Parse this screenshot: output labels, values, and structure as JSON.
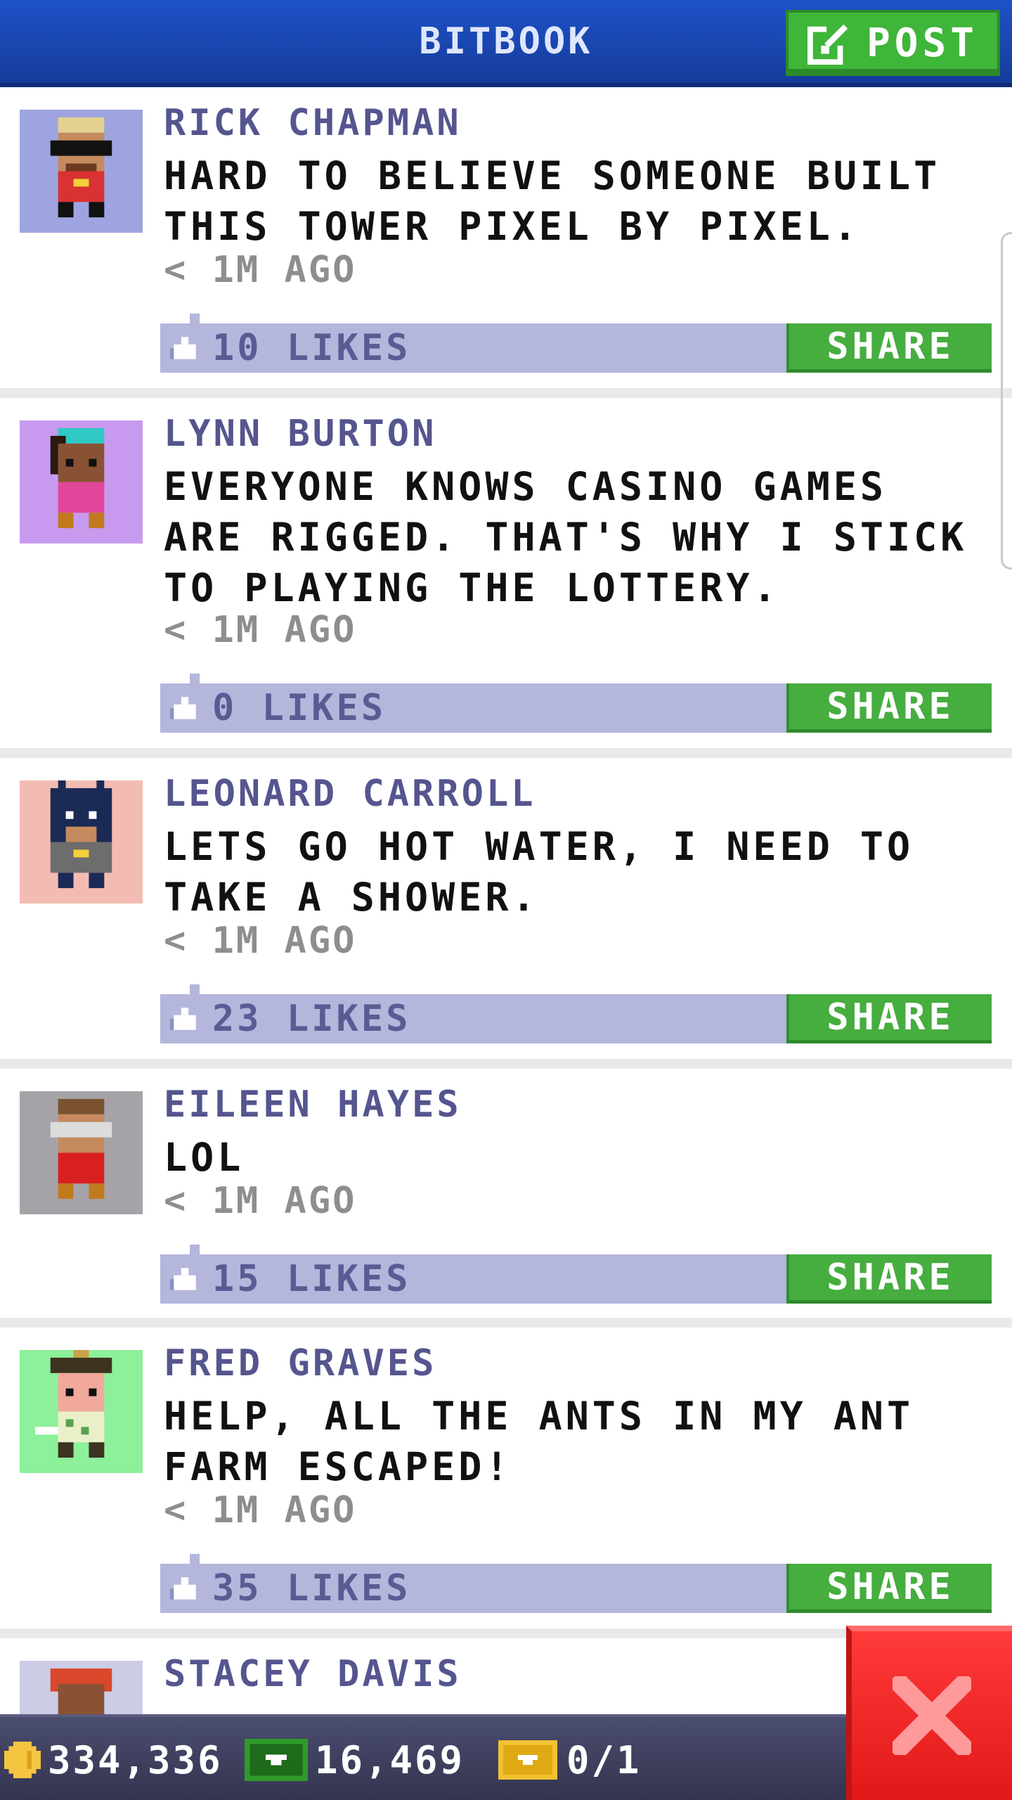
{
  "header": {
    "title": "BITBOOK",
    "post_label": "POST"
  },
  "posts": [
    {
      "author": "RICK CHAPMAN",
      "text": "HARD TO BELIEVE SOMEONE BUILT THIS TOWER PIXEL BY PIXEL.",
      "time": "< 1M AGO",
      "likes": "10 LIKES",
      "share": "SHARE",
      "avatar_bg": "#9ea4df"
    },
    {
      "author": "LYNN BURTON",
      "text": "EVERYONE KNOWS CASINO GAMES ARE RIGGED. THAT'S WHY I STICK TO PLAYING THE LOTTERY.",
      "time": "< 1M AGO",
      "likes": "0 LIKES",
      "share": "SHARE",
      "avatar_bg": "#c79aef"
    },
    {
      "author": "LEONARD CARROLL",
      "text": "LETS GO HOT WATER, I NEED TO TAKE A SHOWER.",
      "time": "< 1M AGO",
      "likes": "23 LIKES",
      "share": "SHARE",
      "avatar_bg": "#f3bcb2"
    },
    {
      "author": "EILEEN HAYES",
      "text": "LOL",
      "time": "< 1M AGO",
      "likes": "15 LIKES",
      "share": "SHARE",
      "avatar_bg": "#a6a3a8"
    },
    {
      "author": "FRED GRAVES",
      "text": "HELP, ALL THE ANTS IN MY ANT FARM ESCAPED!",
      "time": "< 1M AGO",
      "likes": "35 LIKES",
      "share": "SHARE",
      "avatar_bg": "#8df09a"
    },
    {
      "author": "STACEY DAVIS",
      "avatar_bg": "#cccce6"
    }
  ],
  "status": {
    "coins": "334,336",
    "bux": "16,469",
    "tickets": "0/1"
  },
  "colors": {
    "header": "#1a47b8",
    "share_green": "#46ad3f",
    "like_bar": "#b4b6dc",
    "close_red": "#e82020"
  }
}
